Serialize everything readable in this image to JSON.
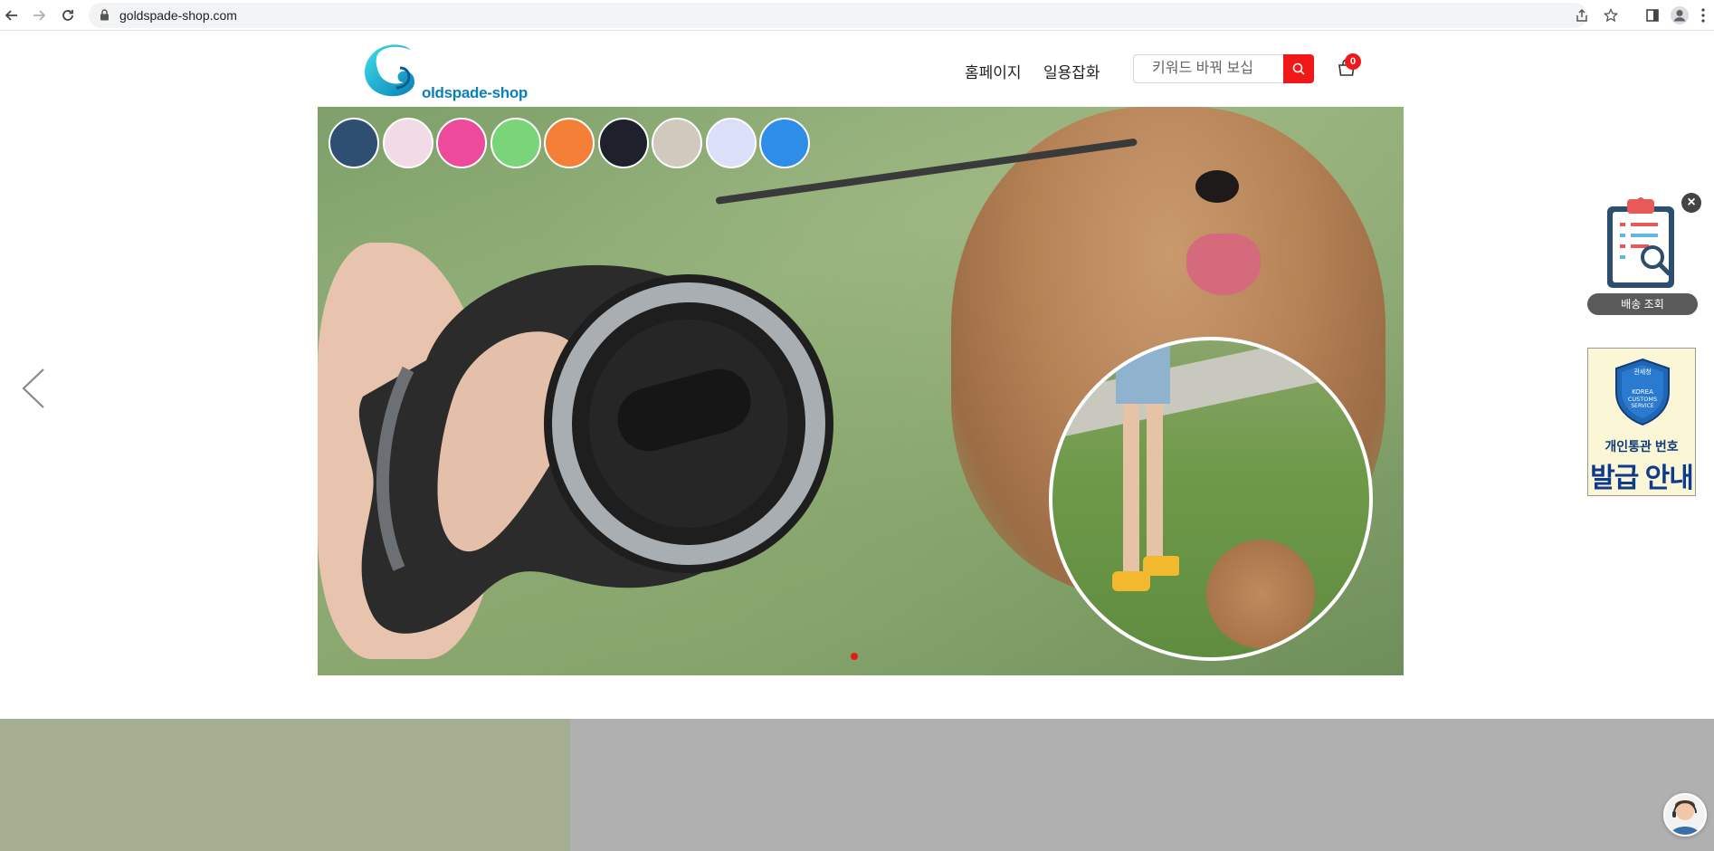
{
  "browser": {
    "url": "goldspade-shop.com"
  },
  "header": {
    "logo_text": "oldspade-shop",
    "nav": [
      {
        "label": "홈페이지"
      },
      {
        "label": "일용잡화"
      }
    ],
    "search_placeholder": "키워드 바꿔 보십",
    "cart_count": "0"
  },
  "hero": {
    "swatch_colors": [
      "#2f4f72",
      "#f0dbe6",
      "#ee4a9c",
      "#79d47a",
      "#f48037",
      "#1e202c",
      "#d1c8be",
      "#dcdff8",
      "#2e8de6"
    ],
    "active_slide": 1
  },
  "widgets": {
    "delivery_label": "배송 조회",
    "close_symbol": "×",
    "customs_line1": "개인통관 번호",
    "customs_line2": "발급 안내",
    "customs_badge_text": "관세청 KOREA CUSTOMS SERVICE"
  },
  "colors": {
    "accent_red": "#f01818",
    "logo_blue": "#0a7fb8"
  }
}
